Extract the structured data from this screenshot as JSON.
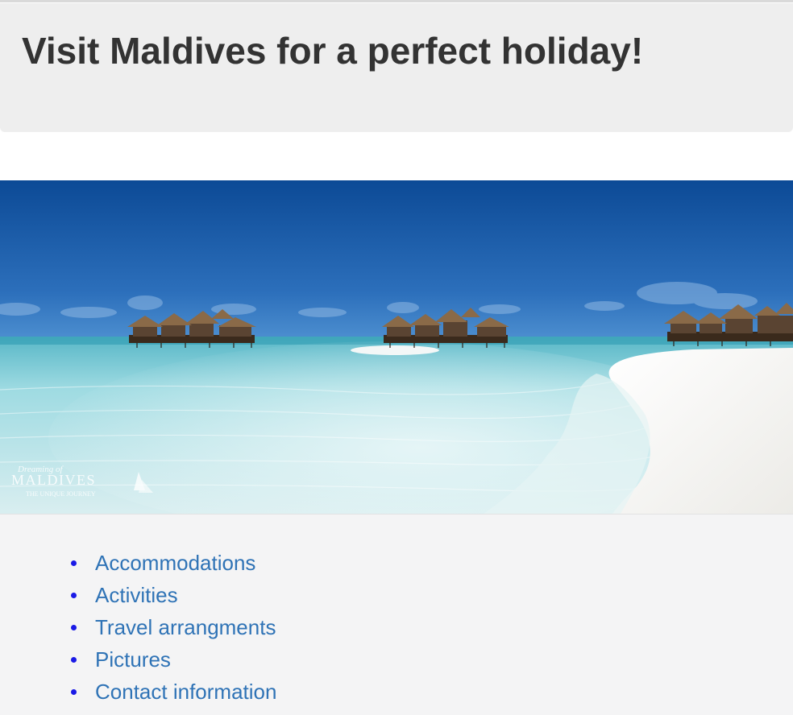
{
  "header": {
    "title": "Visit Maldives for a perfect holiday!"
  },
  "hero": {
    "watermark": {
      "line1": "Dreaming of",
      "line2": "MALDIVES",
      "line3": "THE UNIQUE JOURNEY"
    },
    "colors": {
      "sky_top": "#0e4f9c",
      "sky_bottom": "#3479c2",
      "water_light": "#bfe6ea",
      "water_mid": "#7fcfd8",
      "sand": "#f7f7f5"
    }
  },
  "nav": {
    "bullet_color": "#1a1ae6",
    "link_color": "#2f73b6",
    "items": [
      {
        "label": "Accommodations"
      },
      {
        "label": "Activities"
      },
      {
        "label": "Travel arrangments"
      },
      {
        "label": "Pictures"
      },
      {
        "label": "Contact information"
      }
    ]
  }
}
